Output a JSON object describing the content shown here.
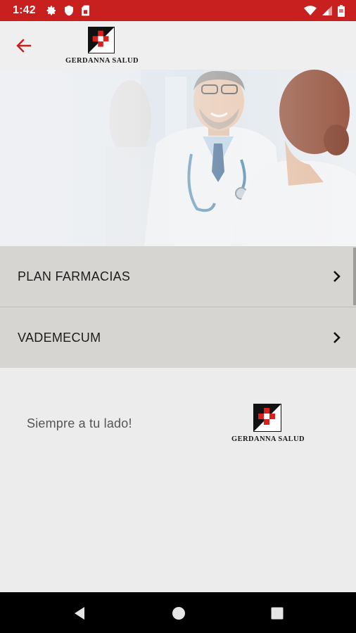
{
  "status_bar": {
    "time": "1:42",
    "icons_left": [
      "settings-icon",
      "shield-icon",
      "sim-card-icon"
    ],
    "icons_right": [
      "wifi-icon",
      "signal-icon",
      "battery-icon"
    ],
    "color": "#c8201e"
  },
  "app_bar": {
    "back_icon": "arrow-left-icon",
    "logo_text": "GERDANNA SALUD",
    "accent_color": "#c8201e"
  },
  "hero": {
    "image": "doctor-with-patient-photo"
  },
  "menu": {
    "items": [
      {
        "label": "PLAN FARMACIAS",
        "icon": "chevron-right-icon"
      },
      {
        "label": "VADEMECUM",
        "icon": "chevron-right-icon"
      }
    ]
  },
  "footer": {
    "tagline": "Siempre a tu lado!",
    "logo_text": "GERDANNA SALUD"
  },
  "nav_bar": {
    "buttons": [
      "back-triangle-icon",
      "home-circle-icon",
      "recents-square-icon"
    ]
  }
}
